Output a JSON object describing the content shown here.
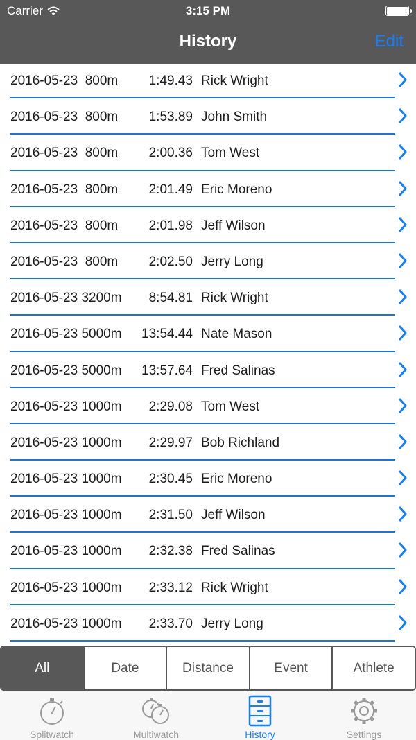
{
  "status_bar": {
    "carrier": "Carrier",
    "time": "3:15 PM"
  },
  "nav": {
    "title": "History",
    "edit": "Edit"
  },
  "rows": [
    {
      "date": "2016-05-23",
      "distance": "800m",
      "time": "1:49.43",
      "athlete": "Rick Wright"
    },
    {
      "date": "2016-05-23",
      "distance": "800m",
      "time": "1:53.89",
      "athlete": "John Smith"
    },
    {
      "date": "2016-05-23",
      "distance": "800m",
      "time": "2:00.36",
      "athlete": "Tom West"
    },
    {
      "date": "2016-05-23",
      "distance": "800m",
      "time": "2:01.49",
      "athlete": "Eric Moreno"
    },
    {
      "date": "2016-05-23",
      "distance": "800m",
      "time": "2:01.98",
      "athlete": "Jeff Wilson"
    },
    {
      "date": "2016-05-23",
      "distance": "800m",
      "time": "2:02.50",
      "athlete": "Jerry Long"
    },
    {
      "date": "2016-05-23",
      "distance": "3200m",
      "time": "8:54.81",
      "athlete": "Rick Wright"
    },
    {
      "date": "2016-05-23",
      "distance": "5000m",
      "time": "13:54.44",
      "athlete": "Nate Mason"
    },
    {
      "date": "2016-05-23",
      "distance": "5000m",
      "time": "13:57.64",
      "athlete": "Fred Salinas"
    },
    {
      "date": "2016-05-23",
      "distance": "1000m",
      "time": "2:29.08",
      "athlete": "Tom West"
    },
    {
      "date": "2016-05-23",
      "distance": "1000m",
      "time": "2:29.97",
      "athlete": "Bob Richland"
    },
    {
      "date": "2016-05-23",
      "distance": "1000m",
      "time": "2:30.45",
      "athlete": "Eric Moreno"
    },
    {
      "date": "2016-05-23",
      "distance": "1000m",
      "time": "2:31.50",
      "athlete": "Jeff Wilson"
    },
    {
      "date": "2016-05-23",
      "distance": "1000m",
      "time": "2:32.38",
      "athlete": "Fred Salinas"
    },
    {
      "date": "2016-05-23",
      "distance": "1000m",
      "time": "2:33.12",
      "athlete": "Rick Wright"
    },
    {
      "date": "2016-05-23",
      "distance": "1000m",
      "time": "2:33.70",
      "athlete": "Jerry Long"
    }
  ],
  "filters": [
    "All",
    "Date",
    "Distance",
    "Event",
    "Athlete"
  ],
  "active_filter": "All",
  "tabs": [
    {
      "label": "Splitwatch",
      "icon": "stopwatch-icon"
    },
    {
      "label": "Multiwatch",
      "icon": "multiwatch-icon"
    },
    {
      "label": "History",
      "icon": "file-cabinet-icon"
    },
    {
      "label": "Settings",
      "icon": "gear-icon"
    }
  ],
  "active_tab": "History",
  "colors": {
    "bar": "#585858",
    "accent": "#147efb",
    "separator": "#1f73d6",
    "inactive_tab": "#9a9a9a"
  }
}
